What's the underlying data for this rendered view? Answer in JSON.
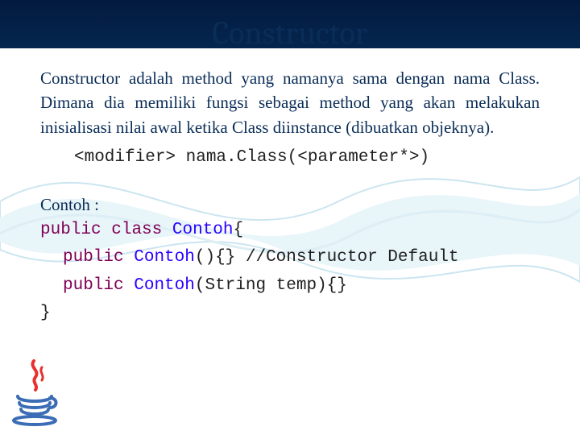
{
  "title": "Constructor",
  "paragraph": "Constructor adalah method yang namanya sama dengan nama Class. Dimana dia memiliki fungsi sebagai method yang akan melakukan inisialisasi nilai awal ketika Class diinstance (dibuatkan objeknya).",
  "syntax": "<modifier> nama.Class(<parameter*>)",
  "example_label": "Contoh :",
  "code": {
    "line1_kw1": "public",
    "line1_kw2": "class",
    "line1_cls": "Contoh",
    "line1_tail": "{",
    "line2_kw": "public",
    "line2_cls": "Contoh",
    "line2_tail": "(){} //Constructor Default",
    "line3_kw": "public",
    "line3_cls": "Contoh",
    "line3_tail": "(String temp){}",
    "line4": "}"
  },
  "logo": "java-logo"
}
